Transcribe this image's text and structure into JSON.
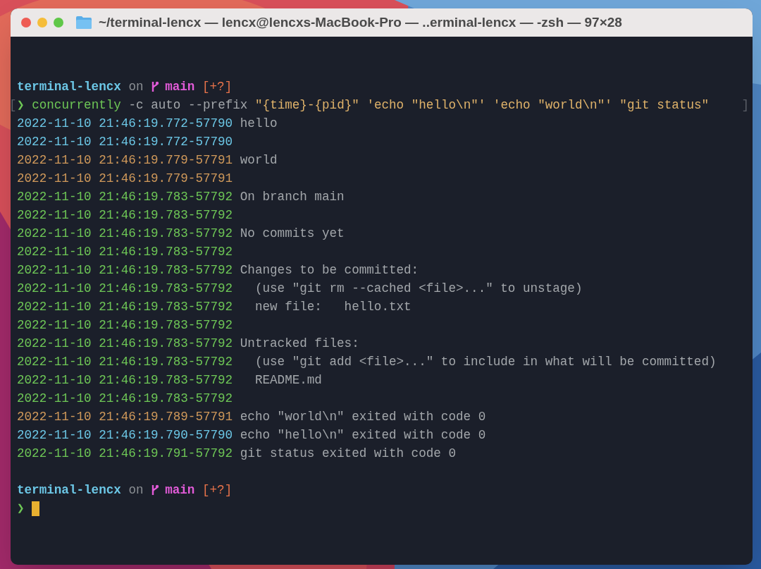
{
  "window": {
    "title": "~/terminal-lencx — lencx@lencxs-MacBook-Pro — ..erminal-lencx — -zsh — 97×28"
  },
  "terminal": {
    "lines": [
      {
        "kind": "blank"
      },
      {
        "kind": "prompt",
        "dir": "terminal-lencx",
        "on": "on",
        "branch": "main",
        "status": "[+?]"
      },
      {
        "kind": "command",
        "open": "[",
        "symbol": "❯",
        "tokens": [
          {
            "text": "concurrently",
            "kind": "program"
          },
          {
            "text": "-c auto --prefix",
            "kind": "arg"
          },
          {
            "text": "\"{time}-{pid}\" 'echo \"hello\\n\"' 'echo \"world\\n\"' \"git status\"",
            "kind": "string"
          }
        ],
        "close": "]"
      },
      {
        "kind": "log",
        "prefix": "2022-11-10 21:46:19.772-57790",
        "color": "#6cc7e6",
        "text": "hello"
      },
      {
        "kind": "log",
        "prefix": "2022-11-10 21:46:19.772-57790",
        "color": "#6cc7e6"
      },
      {
        "kind": "log",
        "prefix": "2022-11-10 21:46:19.779-57791",
        "color": "#d0995a",
        "text": "world"
      },
      {
        "kind": "log",
        "prefix": "2022-11-10 21:46:19.779-57791",
        "color": "#d0995a"
      },
      {
        "kind": "log",
        "prefix": "2022-11-10 21:46:19.783-57792",
        "color": "#6ec756",
        "text": "On branch main"
      },
      {
        "kind": "log",
        "prefix": "2022-11-10 21:46:19.783-57792",
        "color": "#6ec756"
      },
      {
        "kind": "log",
        "prefix": "2022-11-10 21:46:19.783-57792",
        "color": "#6ec756",
        "text": "No commits yet"
      },
      {
        "kind": "log",
        "prefix": "2022-11-10 21:46:19.783-57792",
        "color": "#6ec756"
      },
      {
        "kind": "log",
        "prefix": "2022-11-10 21:46:19.783-57792",
        "color": "#6ec756",
        "text": "Changes to be committed:"
      },
      {
        "kind": "log",
        "prefix": "2022-11-10 21:46:19.783-57792",
        "color": "#6ec756",
        "text": "  (use \"git rm --cached <file>...\" to unstage)"
      },
      {
        "kind": "log",
        "prefix": "2022-11-10 21:46:19.783-57792",
        "color": "#6ec756",
        "text": "  new file:   hello.txt"
      },
      {
        "kind": "log",
        "prefix": "2022-11-10 21:46:19.783-57792",
        "color": "#6ec756"
      },
      {
        "kind": "log",
        "prefix": "2022-11-10 21:46:19.783-57792",
        "color": "#6ec756",
        "text": "Untracked files:"
      },
      {
        "kind": "log",
        "prefix": "2022-11-10 21:46:19.783-57792",
        "color": "#6ec756",
        "text": "  (use \"git add <file>...\" to include in what will be committed)"
      },
      {
        "kind": "log",
        "prefix": "2022-11-10 21:46:19.783-57792",
        "color": "#6ec756",
        "text": "  README.md"
      },
      {
        "kind": "log",
        "prefix": "2022-11-10 21:46:19.783-57792",
        "color": "#6ec756"
      },
      {
        "kind": "log",
        "prefix": "2022-11-10 21:46:19.789-57791",
        "color": "#d0995a",
        "text": "echo \"world\\n\" exited with code 0"
      },
      {
        "kind": "log",
        "prefix": "2022-11-10 21:46:19.790-57790",
        "color": "#6cc7e6",
        "text": "echo \"hello\\n\" exited with code 0"
      },
      {
        "kind": "log",
        "prefix": "2022-11-10 21:46:19.791-57792",
        "color": "#6ec756",
        "text": "git status exited with code 0"
      },
      {
        "kind": "blank"
      },
      {
        "kind": "prompt",
        "dir": "terminal-lencx",
        "on": "on",
        "branch": "main",
        "status": "[+?]"
      },
      {
        "kind": "input",
        "symbol": "❯",
        "cursor": true
      }
    ]
  }
}
